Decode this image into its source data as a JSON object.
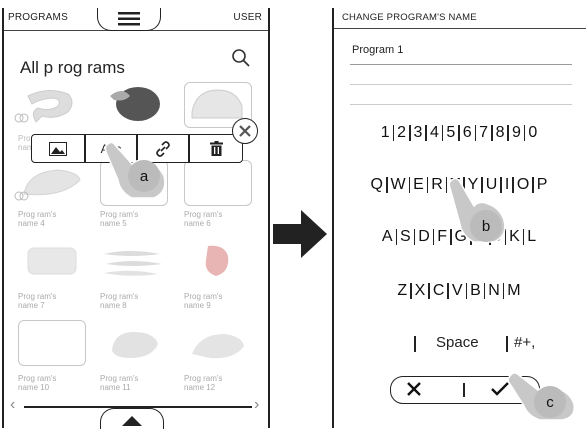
{
  "left_screen": {
    "header": {
      "programs_label": "PROGRAMS",
      "user_label": "USER",
      "menu_icon": "hamburger-icon"
    },
    "title": "All p rog rams",
    "search_icon": "search-icon",
    "popup": {
      "image_icon": "image-icon",
      "text_label": "Abc",
      "link_icon": "link-icon",
      "delete_icon": "trash-icon"
    },
    "close_icon": "close-icon",
    "programs": [
      {
        "label": "Prog ram's name 4"
      },
      {
        "label": "Prog ram's name 5"
      },
      {
        "label": "Prog ram's name 6"
      },
      {
        "label": "Prog ram's name 7"
      },
      {
        "label": "Prog ram's name 8"
      },
      {
        "label": "Prog ram's name 9"
      },
      {
        "label": "Prog ram's name 10"
      },
      {
        "label": "Prog ram's name 11"
      },
      {
        "label": "Prog ram's name 12"
      }
    ],
    "partial_label_1": "Pro",
    "partial_label_2": "nam",
    "scroll_left": "‹",
    "scroll_right": "›"
  },
  "callouts": {
    "a": "a",
    "b": "b",
    "c": "c"
  },
  "arrow_icon": "right-arrow-icon",
  "right_screen": {
    "header": "CHANGE PROGRAM'S NAME",
    "input_value": "Program 1",
    "rows": {
      "digits": [
        "1",
        "2",
        "3",
        "4",
        "5",
        "6",
        "7",
        "8",
        "9",
        "0"
      ],
      "row1": [
        "Q",
        "W",
        "E",
        "R",
        "T",
        "Y",
        "U",
        "I",
        "O",
        "P"
      ],
      "row2": [
        "A",
        "S",
        "D",
        "F",
        "G",
        "H",
        "J",
        "K",
        "L"
      ],
      "row3": [
        "Z",
        "X",
        "C",
        "V",
        "B",
        "N",
        "M"
      ]
    },
    "space_label": "Space",
    "symbols_label": "#+,",
    "cancel_icon": "x-icon",
    "confirm_icon": "check-icon"
  }
}
